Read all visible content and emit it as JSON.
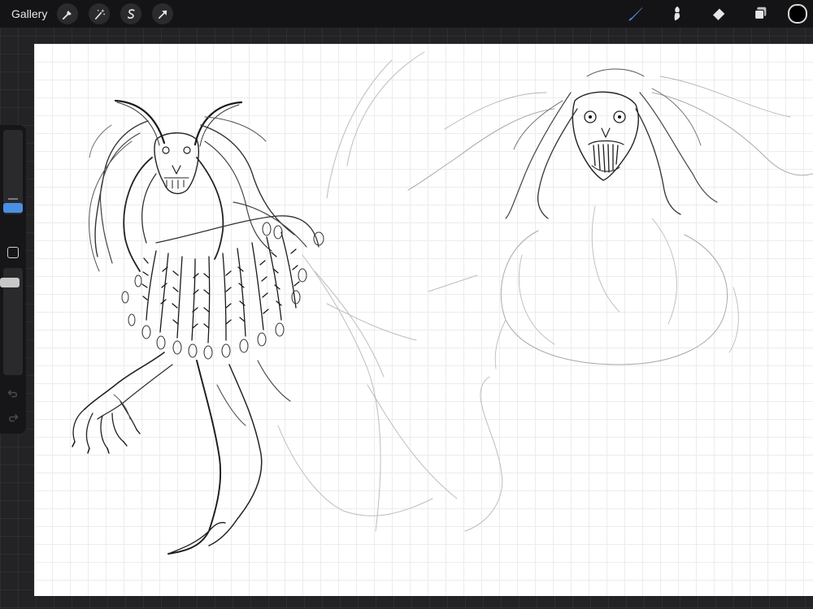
{
  "topbar": {
    "gallery_label": "Gallery",
    "left_tools": [
      {
        "name": "actions",
        "icon": "wrench-icon"
      },
      {
        "name": "adjustments",
        "icon": "magic-wand-icon"
      },
      {
        "name": "selection",
        "icon": "selection-s-icon"
      },
      {
        "name": "transform",
        "icon": "arrow-cursor-icon"
      }
    ],
    "right_tools": [
      {
        "name": "brush",
        "icon": "brush-icon",
        "active": true
      },
      {
        "name": "smudge",
        "icon": "smudge-icon",
        "active": false
      },
      {
        "name": "eraser",
        "icon": "eraser-icon",
        "active": false
      },
      {
        "name": "layers",
        "icon": "layers-icon",
        "active": false
      }
    ],
    "current_color": "#000000",
    "active_tool_color": "#4a90e2"
  },
  "sidebar": {
    "brush_size_slider": {
      "icon": "size-slider"
    },
    "modify_button": {
      "icon": "square-icon"
    },
    "opacity_slider": {
      "icon": "opacity-slider"
    },
    "undo": {
      "icon": "undo-icon"
    },
    "redo": {
      "icon": "redo-icon"
    }
  },
  "canvas": {
    "background": "#ffffff",
    "content": "sketch"
  }
}
